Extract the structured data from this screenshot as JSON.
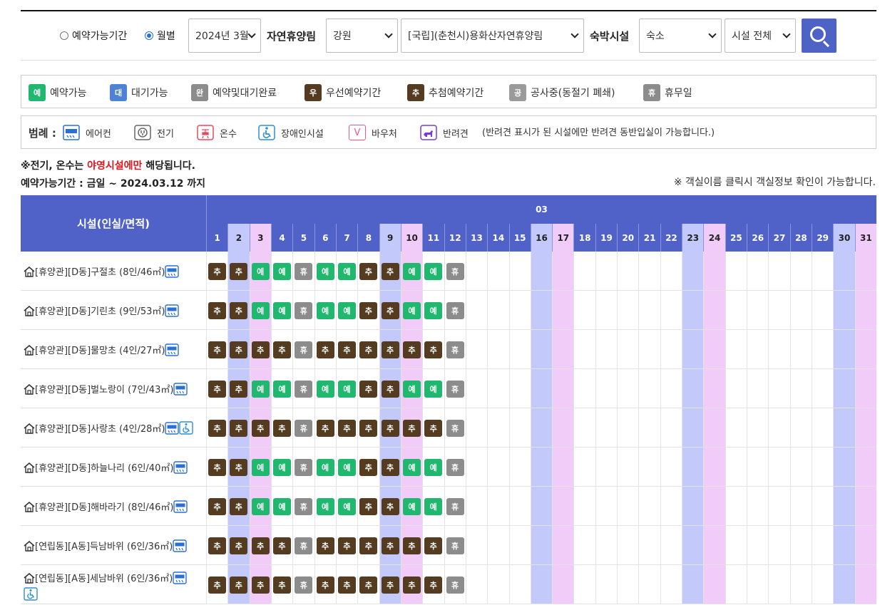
{
  "search": {
    "radio_available": "예약가능기간",
    "radio_monthly": "월별",
    "month_value": "2024년 3월",
    "label_forest": "자연휴양림",
    "region_value": "강원",
    "forest_value": "[국립](춘천시)용화산자연휴양림",
    "label_lodging": "숙박시설",
    "lodging_value": "숙소",
    "facility_value": "시설 전체"
  },
  "status_legend": [
    {
      "badge": "예",
      "label": "예약가능",
      "color": "#1fb86e"
    },
    {
      "badge": "대",
      "label": "대기가능",
      "color": "#4d82d8"
    },
    {
      "badge": "완",
      "label": "예약및대기완료",
      "color": "#8c8c8c"
    },
    {
      "badge": "우",
      "label": "우선예약기간",
      "color": "#553c21"
    },
    {
      "badge": "추",
      "label": "추첨예약기간",
      "color": "#553c21"
    },
    {
      "badge": "공",
      "label": "공사중(동절기 폐쇄)",
      "color": "#9a9a9a"
    },
    {
      "badge": "휴",
      "label": "휴무일",
      "color": "#8c8c8c"
    }
  ],
  "legend": {
    "title": "범례 :",
    "aircon": "에어컨",
    "electric": "전기",
    "hotwater": "온수",
    "disabled": "장애인시설",
    "voucher": "바우처",
    "voucher_glyph": "V",
    "pet": "반려견",
    "pet_note": "(반려견 표시가 된 시설에만 반려견 동반입실이 가능합니다.)"
  },
  "notes": {
    "note1_prefix": "※전기, 온수는 ",
    "note1_red": "야영시설에만",
    "note1_suffix": " 해당됩니다.",
    "note2": "예약가능기간 : 금일 ~ 2024.03.12 까지",
    "note3": "※ 객실이름 클릭시 객실정보 확인이 가능합니다."
  },
  "grid": {
    "header_facility": "시설(인실/면적)",
    "month": "03",
    "days": [
      "1",
      "2",
      "3",
      "4",
      "5",
      "6",
      "7",
      "8",
      "9",
      "10",
      "11",
      "12",
      "13",
      "14",
      "15",
      "16",
      "17",
      "18",
      "19",
      "20",
      "21",
      "22",
      "23",
      "24",
      "25",
      "26",
      "27",
      "28",
      "29",
      "30",
      "31"
    ],
    "saturdays": [
      "2",
      "9",
      "16",
      "23",
      "30"
    ],
    "sundays": [
      "3",
      "10",
      "17",
      "24",
      "31"
    ],
    "badge_colors": {
      "추": "#553c21",
      "예": "#1fb86e",
      "휴": "#8c8c8c"
    },
    "rooms": [
      {
        "name": "[휴양관][D동]구절초 (8인/46㎡)",
        "aircon": true,
        "disabled": false,
        "status": [
          "추",
          "추",
          "예",
          "예",
          "휴",
          "예",
          "예",
          "추",
          "추",
          "예",
          "예",
          "휴"
        ]
      },
      {
        "name": "[휴양관][D동]기린초 (9인/53㎡)",
        "aircon": true,
        "disabled": false,
        "status": [
          "추",
          "추",
          "예",
          "예",
          "휴",
          "예",
          "예",
          "추",
          "추",
          "예",
          "예",
          "휴"
        ]
      },
      {
        "name": "[휴양관][D동]물망초 (4인/27㎡)",
        "aircon": true,
        "disabled": false,
        "status": [
          "추",
          "추",
          "추",
          "추",
          "휴",
          "추",
          "추",
          "추",
          "추",
          "추",
          "추",
          "휴"
        ]
      },
      {
        "name": "[휴양관][D동]벌노랑이 (7인/43㎡)",
        "aircon": true,
        "disabled": false,
        "status": [
          "추",
          "추",
          "예",
          "예",
          "휴",
          "예",
          "예",
          "추",
          "추",
          "예",
          "예",
          "휴"
        ]
      },
      {
        "name": "[휴양관][D동]사랑초 (4인/28㎡)",
        "aircon": true,
        "disabled": true,
        "status": [
          "추",
          "추",
          "추",
          "추",
          "휴",
          "추",
          "추",
          "추",
          "추",
          "추",
          "추",
          "휴"
        ]
      },
      {
        "name": "[휴양관][D동]하늘나리 (6인/40㎡)",
        "aircon": true,
        "disabled": false,
        "status": [
          "추",
          "추",
          "예",
          "예",
          "휴",
          "예",
          "예",
          "추",
          "추",
          "예",
          "예",
          "휴"
        ]
      },
      {
        "name": "[휴양관][D동]해바라기 (8인/46㎡)",
        "aircon": true,
        "disabled": false,
        "status": [
          "추",
          "추",
          "예",
          "예",
          "휴",
          "예",
          "예",
          "추",
          "추",
          "예",
          "예",
          "휴"
        ]
      },
      {
        "name": "[연립동][A동]득남바위 (6인/36㎡)",
        "aircon": true,
        "disabled": false,
        "status": [
          "추",
          "추",
          "추",
          "추",
          "휴",
          "추",
          "추",
          "추",
          "추",
          "추",
          "추",
          "휴"
        ]
      },
      {
        "name": "[연립동][A동]세남바위 (6인/36㎡)",
        "aircon": true,
        "disabled": true,
        "status": [
          "추",
          "추",
          "추",
          "추",
          "휴",
          "추",
          "추",
          "추",
          "추",
          "추",
          "추",
          "휴"
        ]
      }
    ]
  }
}
